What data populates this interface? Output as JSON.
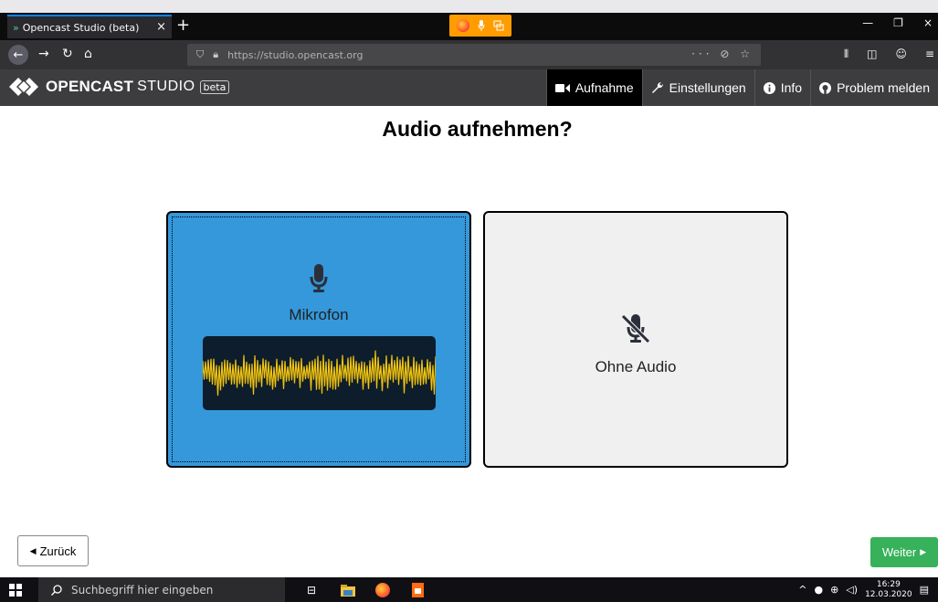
{
  "browser": {
    "tab_title": "Opencast Studio (beta)",
    "tab_icon": "»",
    "tab_close": "×",
    "new_tab": "+",
    "url": "https://studio.opencast.org",
    "url_actions": "··· ⊘ ☆",
    "window_controls": [
      "—",
      "❐",
      "×"
    ]
  },
  "app": {
    "logo_text": "OPENCAST",
    "logo_studio": "STUDIO",
    "logo_beta": "beta",
    "nav": [
      {
        "label": "Aufnahme",
        "icon": "video-camera-icon"
      },
      {
        "label": "Einstellungen",
        "icon": "wrench-icon"
      },
      {
        "label": "Info",
        "icon": "info-circle-icon"
      },
      {
        "label": "Problem melden",
        "icon": "github-icon"
      }
    ]
  },
  "main": {
    "heading": "Audio aufnehmen?",
    "options": [
      {
        "label": "Mikrofon",
        "icon": "microphone-icon",
        "selected": true
      },
      {
        "label": "Ohne Audio",
        "icon": "microphone-slash-icon",
        "selected": false
      }
    ],
    "back_label": "Zurück",
    "next_label": "Weiter"
  },
  "taskbar": {
    "search_placeholder": "Suchbegriff hier eingeben",
    "time": "16:29",
    "date": "12.03.2020"
  },
  "colors": {
    "selected_card": "#3498db",
    "unselected_card": "#f0f0f0",
    "waveform": "#f2c40f",
    "next_button": "#37b15a"
  }
}
